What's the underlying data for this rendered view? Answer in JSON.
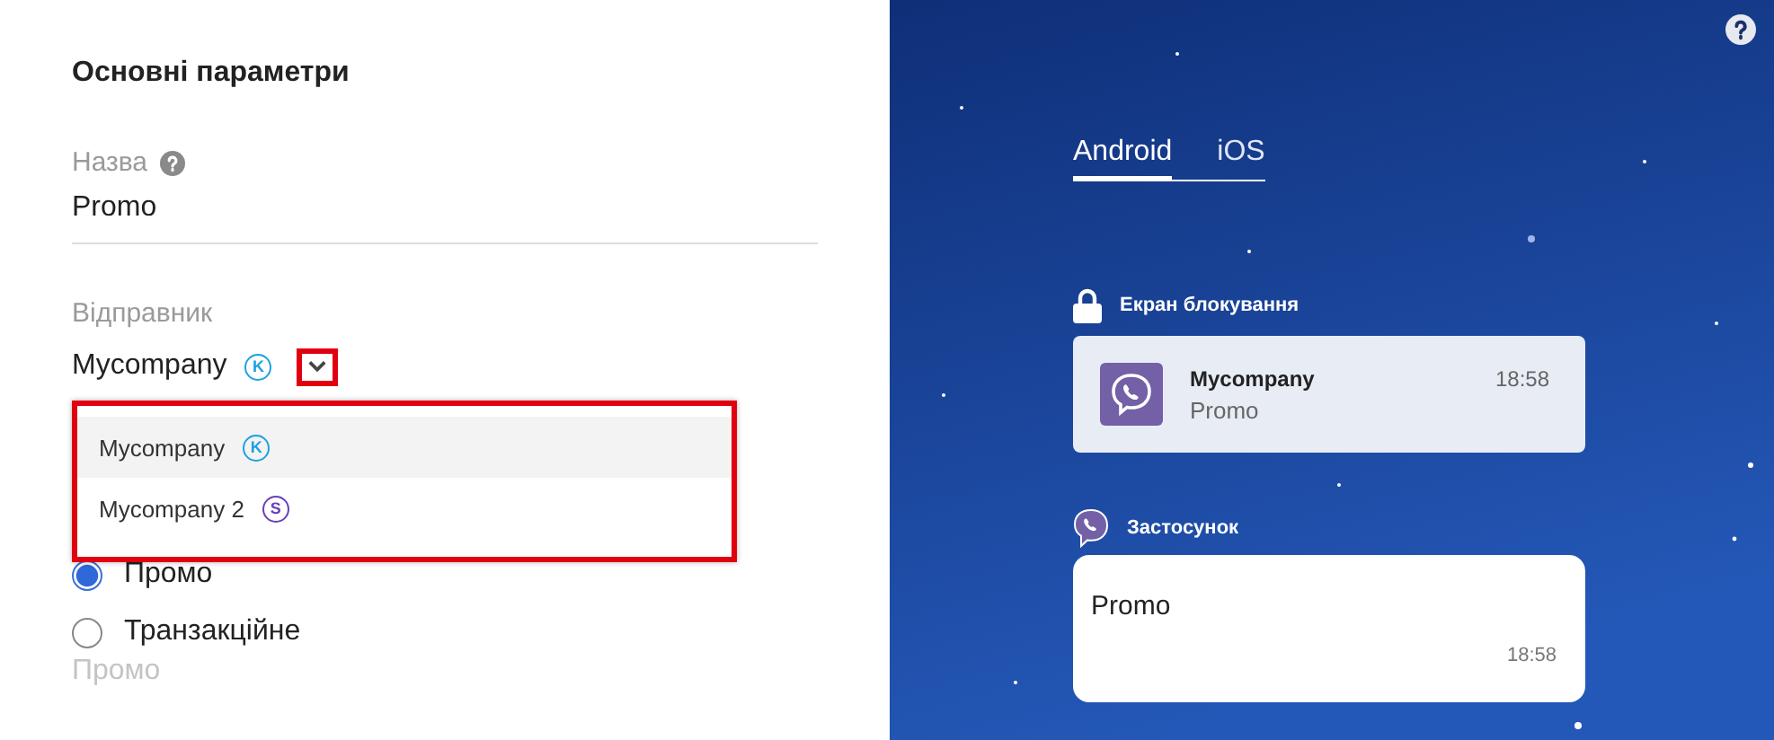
{
  "form": {
    "title": "Основні параметри",
    "name_field": {
      "label": "Назва",
      "value": "Promo"
    },
    "sender_field": {
      "label": "Відправник",
      "value": "Mycompany",
      "badge": "K",
      "color": "#1ba1e2"
    },
    "sender_options": [
      {
        "name": "Mycompany",
        "badge": "K",
        "color": "#1ba1e2",
        "selected": true
      },
      {
        "name": "Mycompany 2",
        "badge": "S",
        "color": "#6b3fb8",
        "selected": false
      }
    ],
    "message_types": [
      {
        "label": "Промо",
        "selected": true
      },
      {
        "label": "Транзакційне",
        "selected": false
      }
    ],
    "type_hint": "Промо"
  },
  "preview": {
    "tabs": [
      {
        "label": "Android",
        "selected": true
      },
      {
        "label": "iOS",
        "selected": false
      }
    ],
    "lock_screen": {
      "title": "Екран блокування",
      "sender": "Mycompany",
      "time": "18:58",
      "text": "Promo"
    },
    "app": {
      "title": "Застосунок",
      "text": "Promo",
      "time": "18:58"
    }
  }
}
